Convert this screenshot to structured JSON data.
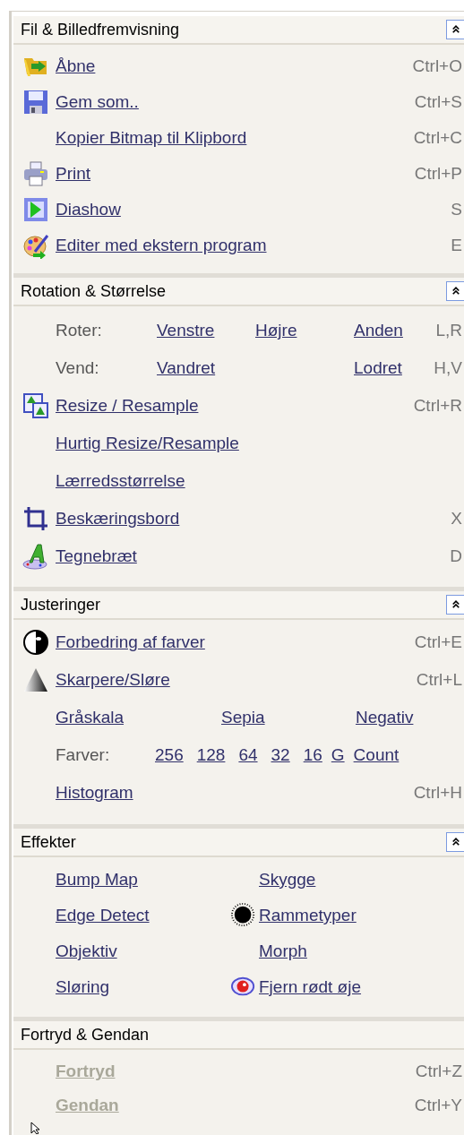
{
  "sections": [
    {
      "title": "Fil & Billedfremvisning",
      "collapsible": true,
      "rows": [
        {
          "kind": "item",
          "label": "Åbne",
          "shortcut": "Ctrl+O"
        },
        {
          "kind": "item",
          "label": "Gem som..",
          "shortcut": "Ctrl+S"
        },
        {
          "kind": "item",
          "label": "Kopier Bitmap til Klipbord",
          "shortcut": "Ctrl+C"
        },
        {
          "kind": "item",
          "label": "Print",
          "shortcut": "Ctrl+P"
        },
        {
          "kind": "item",
          "label": "Diashow",
          "shortcut": "S"
        },
        {
          "kind": "item",
          "label": "Editer med ekstern program",
          "shortcut": "E"
        }
      ]
    },
    {
      "title": "Rotation & Størrelse",
      "collapsible": true,
      "rows": [
        {
          "kind": "options",
          "label": "Roter:",
          "links": [
            "Venstre",
            "Højre",
            "Anden"
          ],
          "shortcut": "L,R"
        },
        {
          "kind": "options",
          "label": "Vend:",
          "links": [
            "Vandret",
            "Lodret"
          ],
          "shortcut": "H,V"
        },
        {
          "kind": "item",
          "label": "Resize / Resample",
          "shortcut": "Ctrl+R"
        },
        {
          "kind": "item",
          "label": "Hurtig Resize/Resample"
        },
        {
          "kind": "item",
          "label": "Lærredsstørrelse"
        },
        {
          "kind": "item",
          "label": "Beskæringsbord",
          "shortcut": "X"
        },
        {
          "kind": "item",
          "label": "Tegnebræt",
          "shortcut": "D"
        }
      ]
    },
    {
      "title": "Justeringer",
      "collapsible": true,
      "rows": [
        {
          "kind": "item",
          "label": "Forbedring af farver",
          "shortcut": "Ctrl+E"
        },
        {
          "kind": "item",
          "label": "Skarpere/Sløre",
          "shortcut": "Ctrl+L"
        },
        {
          "kind": "spread",
          "links": [
            "Gråskala",
            "Sepia",
            "Negativ"
          ]
        },
        {
          "kind": "inline",
          "label": "Farver:",
          "links": [
            "256",
            "128",
            "64",
            "32",
            "16",
            "G",
            "Count"
          ]
        },
        {
          "kind": "item",
          "label": "Histogram",
          "shortcut": "Ctrl+H"
        }
      ]
    },
    {
      "title": "Effekter",
      "collapsible": true,
      "rows": [
        {
          "kind": "pair",
          "links": [
            "Bump Map",
            "Skygge"
          ]
        },
        {
          "kind": "pair",
          "links": [
            "Edge Detect",
            "Rammetyper"
          ]
        },
        {
          "kind": "pair",
          "links": [
            "Objektiv",
            "Morph"
          ]
        },
        {
          "kind": "pair",
          "links": [
            "Sløring",
            "Fjern rødt øje"
          ]
        }
      ]
    },
    {
      "title": "Fortryd & Gendan",
      "collapsible": false,
      "rows": [
        {
          "kind": "item",
          "label": "Fortryd",
          "shortcut": "Ctrl+Z",
          "disabled": true
        },
        {
          "kind": "item",
          "label": "Gendan",
          "shortcut": "Ctrl+Y",
          "disabled": true
        }
      ]
    }
  ]
}
